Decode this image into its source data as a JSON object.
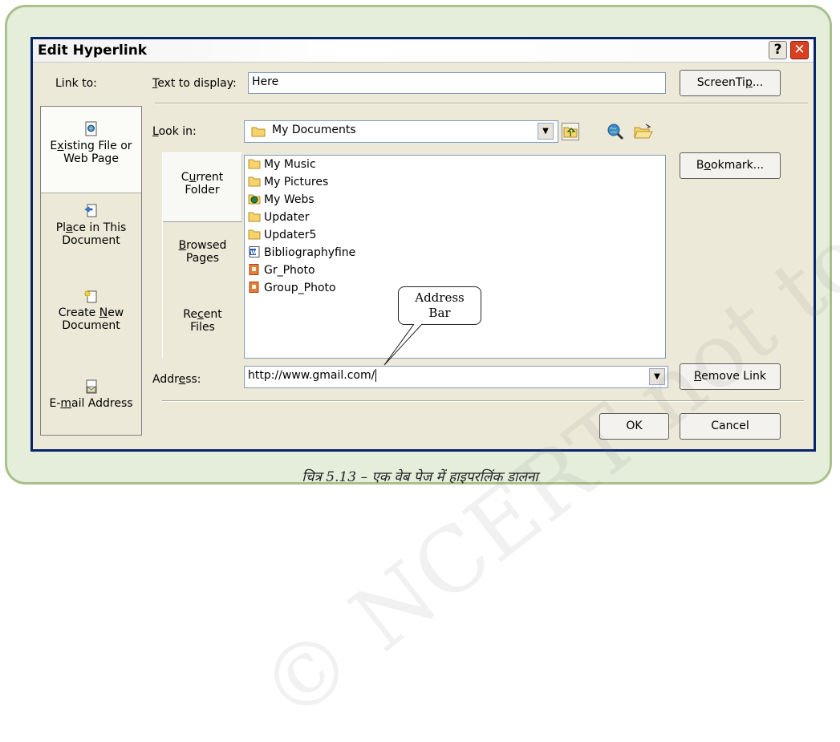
{
  "dialog": {
    "title": "Edit Hyperlink",
    "help_label": "?",
    "close_label": "✕"
  },
  "link_to_label": "Link to:",
  "sidebar": {
    "items": [
      {
        "pre": "E",
        "u": "x",
        "post": "isting File or",
        "line2": "Web Page",
        "icon": "existing-file-icon",
        "active": true
      },
      {
        "pre": "Pl",
        "u": "a",
        "post": "ce in This",
        "line2": "Document",
        "icon": "place-in-document-icon",
        "active": false
      },
      {
        "pre": "Create ",
        "u": "N",
        "post": "ew",
        "line2": "Document",
        "icon": "new-document-icon",
        "active": false
      },
      {
        "pre": "E-",
        "u": "m",
        "post": "ail Address",
        "line2": "",
        "icon": "email-icon",
        "active": false
      }
    ]
  },
  "text_to_display": {
    "label_u": "T",
    "label_rest": "ext to display:",
    "value": "Here"
  },
  "look_in": {
    "label_u": "L",
    "label_rest": "ook in:",
    "value": "My Documents"
  },
  "tabs": [
    {
      "pre": "C",
      "u": "u",
      "post": "rrent",
      "line2": "Folder",
      "active": true
    },
    {
      "pre": "",
      "u": "B",
      "post": "rowsed",
      "line2": "Pages",
      "active": false
    },
    {
      "pre": "Re",
      "u": "c",
      "post": "ent",
      "line2": "Files",
      "active": false
    }
  ],
  "files": [
    {
      "name": "My Music",
      "icon": "folder-icon"
    },
    {
      "name": "My Pictures",
      "icon": "folder-icon"
    },
    {
      "name": "My Webs",
      "icon": "web-folder-icon"
    },
    {
      "name": "Updater",
      "icon": "folder-icon"
    },
    {
      "name": "Updater5",
      "icon": "folder-icon"
    },
    {
      "name": "Bibliographyfine",
      "icon": "word-document-icon"
    },
    {
      "name": "Gr_Photo",
      "icon": "photo-file-icon"
    },
    {
      "name": "Group_Photo",
      "icon": "photo-file-icon"
    }
  ],
  "address": {
    "label_pre": "Addr",
    "label_u": "e",
    "label_post": "ss:",
    "value": "http://www.gmail.com/"
  },
  "buttons": {
    "screentip": {
      "pre": "ScreenTi",
      "u": "p",
      "post": "..."
    },
    "bookmark": {
      "pre": "B",
      "u": "o",
      "post": "okmark..."
    },
    "remove_link": {
      "pre": "",
      "u": "R",
      "post": "emove Link"
    },
    "ok": "OK",
    "cancel": "Cancel"
  },
  "callout": {
    "line1": "Address",
    "line2": "Bar"
  },
  "caption": "चित्र 5.13 – एक वेब पेज में हाइपरलिंक डालना",
  "watermark": "© NCERT not to be republished",
  "colors": {
    "frame_border": "#a9c08a",
    "frame_bg": "#e4eedb",
    "dialog_bg": "#ece9d8",
    "close_red": "#d9401f"
  }
}
